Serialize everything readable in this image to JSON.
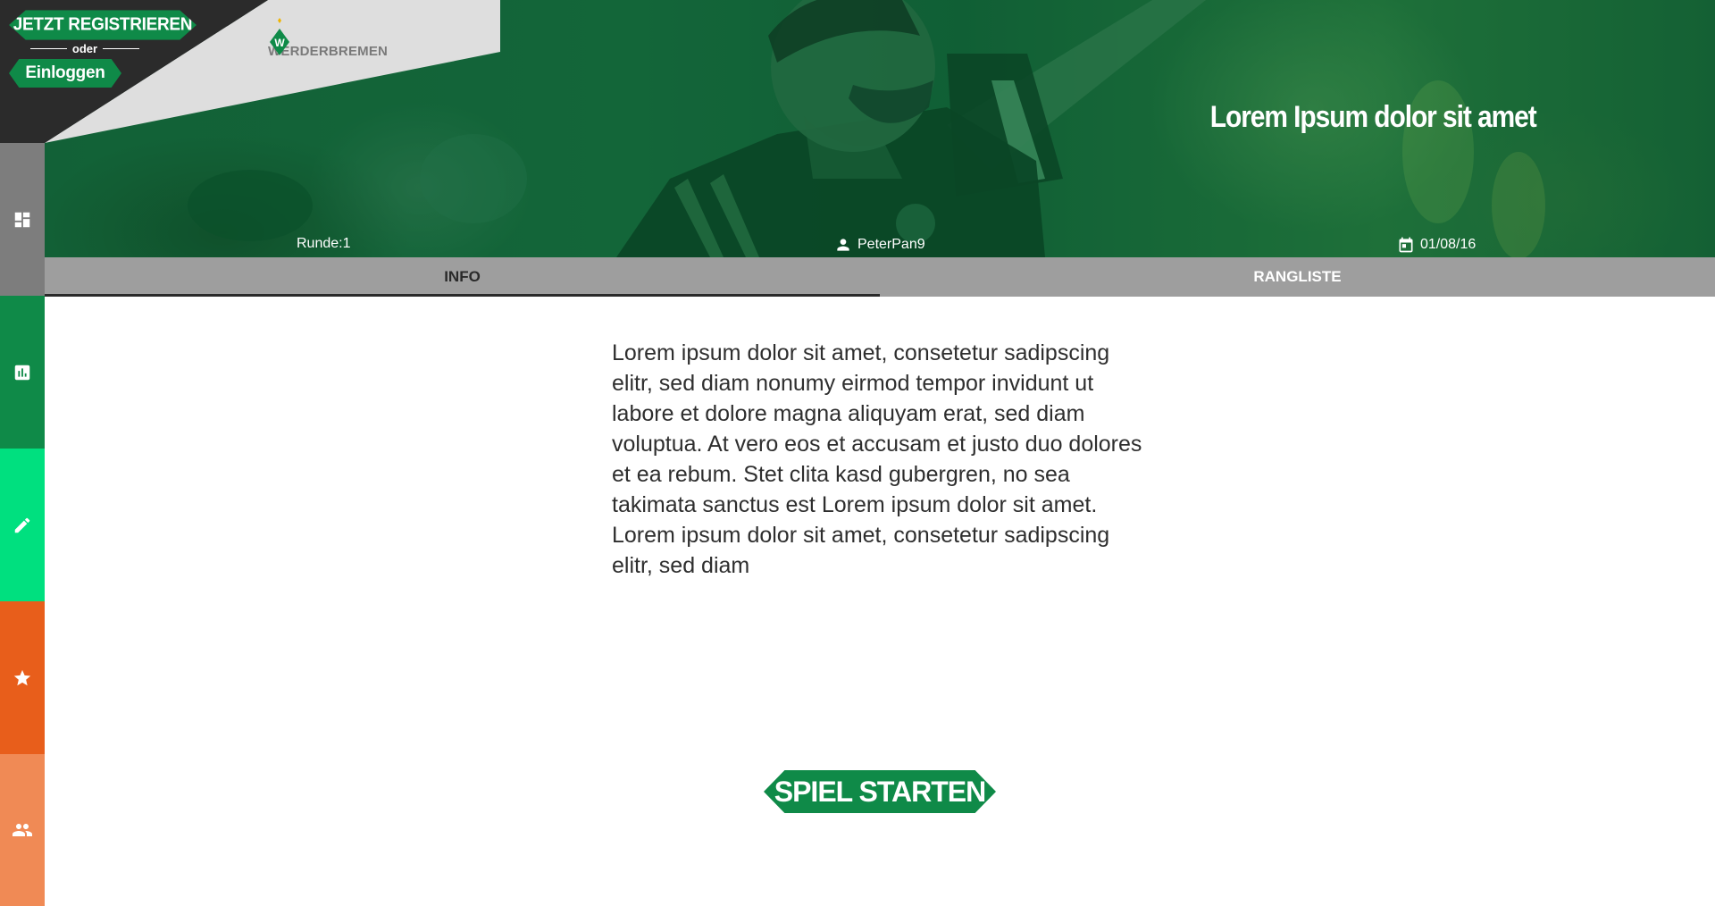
{
  "account": {
    "register_label": "JETZT REGISTRIEREN",
    "or_label": "oder",
    "login_label": "Einloggen"
  },
  "logo": {
    "word_left": "WERDER",
    "word_right": "BREMEN",
    "mark_letter": "W"
  },
  "hero": {
    "title": "Lorem Ipsum dolor sit amet",
    "round": "Runde:1",
    "user": "PeterPan9",
    "date": "01/08/16"
  },
  "tabs": [
    {
      "label": "INFO",
      "active": true
    },
    {
      "label": "RANGLISTE",
      "active": false
    }
  ],
  "sidebar": {
    "items": [
      {
        "icon": "dashboard-icon",
        "color": "#7d7d7d"
      },
      {
        "icon": "bar-chart-icon",
        "color": "#0f8a48"
      },
      {
        "icon": "pencil-icon",
        "color": "#00e07f"
      },
      {
        "icon": "star-icon",
        "color": "#e85e1b"
      },
      {
        "icon": "group-icon",
        "color": "#f08a55"
      }
    ]
  },
  "content": {
    "text": "Lorem ipsum dolor sit amet, consetetur sadipscing elitr, sed diam nonumy eirmod tempor invidunt ut labore et dolore magna aliquyam erat, sed diam voluptua. At vero eos et accusam et justo duo dolores et ea rebum. Stet clita kasd gubergren, no sea takimata sanctus est Lorem ipsum dolor sit amet. Lorem ipsum dolor sit amet, consetetur sadipscing elitr, sed diam",
    "start_label": "SPIEL STARTEN"
  },
  "colors": {
    "brand_green": "#0f8a48",
    "tab_bar": "#9e9e9e",
    "corner_dark": "#2b2b2b",
    "corner_light": "#dedede"
  }
}
